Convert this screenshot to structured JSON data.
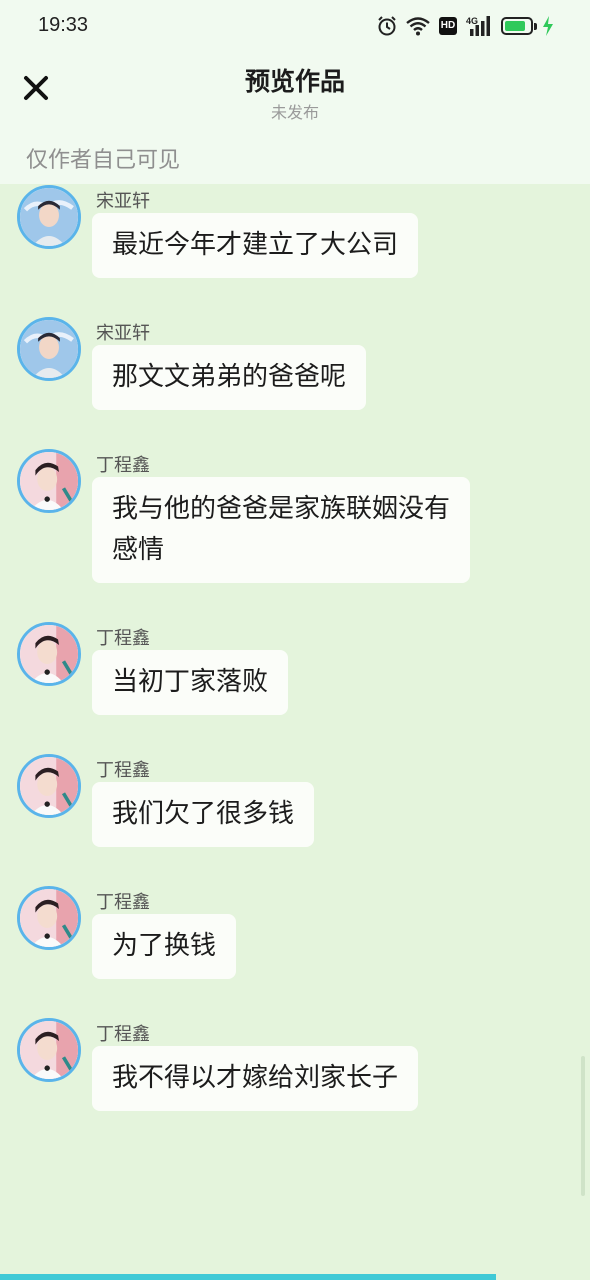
{
  "status_bar": {
    "time": "19:33",
    "hd_badge": "HD",
    "network": "4G",
    "battery_level": 0.85,
    "icons": [
      "alarm-icon",
      "wifi-icon",
      "hd-icon",
      "signal-icon",
      "battery-icon",
      "charging-icon"
    ]
  },
  "header": {
    "close_icon": "close-icon",
    "title": "预览作品",
    "subtitle": "未发布"
  },
  "visibility_note": "仅作者自己可见",
  "messages": [
    {
      "sender": "宋亚轩",
      "text": "最近今年才建立了大公司",
      "avatar": "avatar-songyaxuan"
    },
    {
      "sender": "宋亚轩",
      "text": "那文文弟弟的爸爸呢",
      "avatar": "avatar-songyaxuan"
    },
    {
      "sender": "丁程鑫",
      "text": "我与他的爸爸是家族联姻没有\n感情",
      "avatar": "avatar-dingchengxin"
    },
    {
      "sender": "丁程鑫",
      "text": "当初丁家落败",
      "avatar": "avatar-dingchengxin"
    },
    {
      "sender": "丁程鑫",
      "text": "我们欠了很多钱",
      "avatar": "avatar-dingchengxin"
    },
    {
      "sender": "丁程鑫",
      "text": "为了换钱",
      "avatar": "avatar-dingchengxin"
    },
    {
      "sender": "丁程鑫",
      "text": "我不得以才嫁给刘家长子",
      "avatar": "avatar-dingchengxin"
    }
  ],
  "progress": 0.84,
  "colors": {
    "background": "#e4f4dc",
    "header_bg": "#f1faf0",
    "bubble_bg": "#fbfdf9",
    "avatar_border": "#5ab4ea",
    "progress": "#3fc9d6"
  }
}
